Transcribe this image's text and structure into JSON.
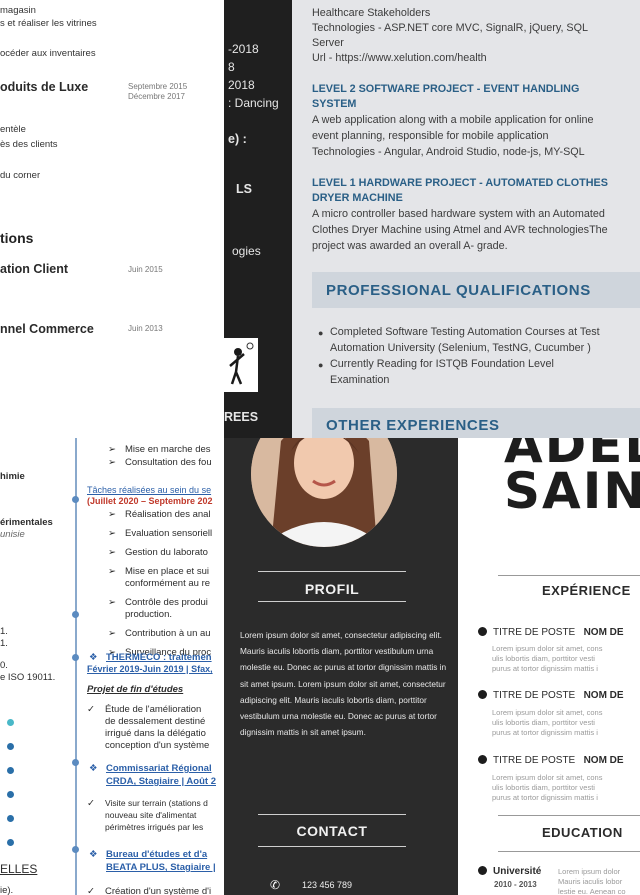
{
  "panel_a": {
    "lines": [
      "magasin",
      "s et réaliser les vitrines",
      "océder aux inventaires"
    ],
    "luxury_title": "oduits de Luxe",
    "luxury_dates": [
      "Septembre 2015",
      "Décembre 2017"
    ],
    "luxury_lines": [
      "entèle",
      "ès des clients",
      "du corner"
    ],
    "section": "tions",
    "item1_title": "ation Client",
    "item1_date": "Juin 2015",
    "item2_title": "nnel Commerce",
    "item2_date": "Juin 2013"
  },
  "panel_b": {
    "lines": [
      "-2018",
      "8",
      "2018",
      ": Dancing",
      "e) :",
      "LS",
      "ogies",
      "REES"
    ]
  },
  "panel_c": {
    "top_lines": [
      "Healthcare Stakeholders",
      "Technologies - ASP.NET core MVC, SignalR, jQuery, SQL",
      "Server",
      "Url - https://www.xelution.com/health"
    ],
    "proj2_title": [
      "LEVEL 2 SOFTWARE PROJECT - EVENT HANDLING",
      "SYSTEM"
    ],
    "proj2_lines": [
      "A web application along with a mobile application for online",
      "event planning, responsible for mobile application",
      "Technologies - Angular, Android Studio, node-js, MY-SQL"
    ],
    "proj1_title": [
      "LEVEL 1 HARDWARE PROJECT - AUTOMATED CLOTHES",
      "DRYER MACHINE"
    ],
    "proj1_lines": [
      "A micro controller based hardware system with an Automated",
      "Clothes Dryer Machine using Atmel and AVR technologiesThe",
      "project was awarded an overall A- grade."
    ],
    "section_qual": "PROFESSIONAL QUALIFICATIONS",
    "qual_bullets": [
      [
        "Completed Software Testing Automation Courses at Test",
        "Automation University (Selenium, TestNG, Cucumber )"
      ],
      [
        "Currently Reading for ISTQB Foundation Level",
        "Examination"
      ]
    ],
    "section_other": "OTHER EXPERIENCES"
  },
  "panel_d": {
    "left_lines": [
      "himie",
      "érimentales",
      "unisie",
      "1.",
      "1.",
      "0.",
      "e ISO 19011.",
      "ELLES",
      "ie)."
    ],
    "right_top": [
      "Mise en marche des",
      "Consultation des fou"
    ],
    "task_header": "Tâches réalisées au sein du se",
    "task_dates": "(Juillet 2020 – Septembre 202",
    "tasks": [
      "Réalisation des anal",
      "Evaluation sensoriell",
      "Gestion du laborato",
      "Mise en place et sui",
      "conformément au re",
      "Contrôle des produi",
      "production.",
      "Contribution à un au",
      "Surveillance du proc"
    ],
    "thermeco_name": "THERMECO : traitemen",
    "thermeco_dates": "Février 2019-Juin 2019 | Sfax,",
    "project_label": "Projet de fin d'études",
    "study_lines": [
      "Étude de l'amélioration",
      "de dessalement destiné",
      "irrigué dans la délégatio",
      "conception d'un système"
    ],
    "crda_lines": [
      "Commissariat Régional",
      "CRDA, Stagiaire | Août 2"
    ],
    "visit_lines": [
      "Visite sur terrain (stations d",
      "nouveau site d'alimentat",
      "périmètres irrigués par les"
    ],
    "bureau_lines": [
      "Bureau d'études et d'a",
      "BEATA PLUS, Stagiaire |"
    ],
    "creation_line": "Création d'un système d'i"
  },
  "panel_e": {
    "profile_heading": "PROFIL",
    "profile_text": "Lorem ipsum dolor sit amet, consectetur adipiscing elit. Mauris iaculis lobortis diam, porttitor vestibulum urna molestie eu. Donec ac purus at tortor dignissim mattis in sit amet ipsum. Lorem ipsum dolor sit amet, consectetur adipiscing elit. Mauris iaculis lobortis diam, porttitor vestibulum urna molestie eu. Donec ac purus at tortor dignissim mattis in sit amet ipsum.",
    "contact_heading": "CONTACT",
    "phone": "123 456 789"
  },
  "panel_f": {
    "name_top": "ADELA",
    "name_bottom": "SAINDU",
    "experience_heading": "EXPÉRIENCE",
    "job_label": "TITRE DE POSTE",
    "job_company": "NOM DE",
    "job_lorem": [
      "Lorem ipsum dolor sit amet, cons",
      "ulis lobortis diam, porttitor vesti",
      "purus at tortor dignissim mattis i"
    ],
    "education_heading": "EDUCATION",
    "edu_school": "Université",
    "edu_years": "2010 - 2013",
    "edu_lorem": [
      "Lorem ipsum dolor",
      "Mauris iaculis lobor",
      "lestie eu. Aenean co"
    ]
  }
}
